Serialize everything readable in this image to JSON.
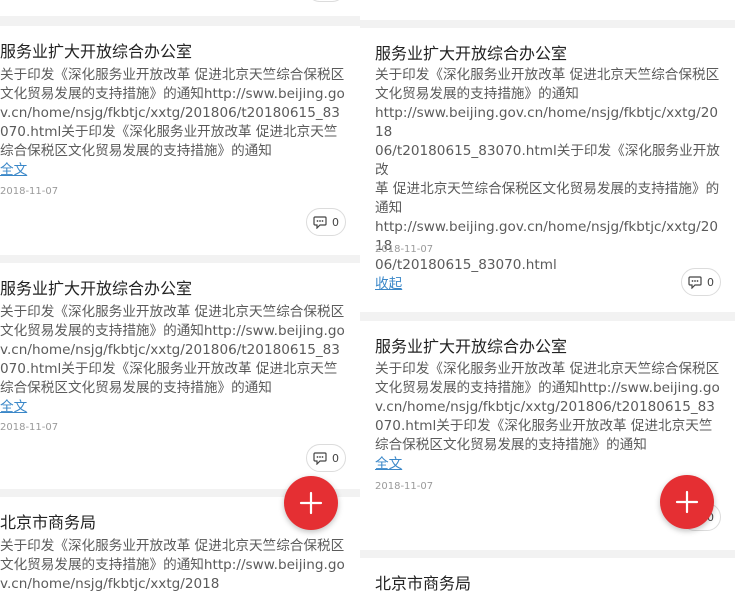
{
  "left_panel": {
    "cards": [
      {
        "title": "服务业扩大开放综合办公室",
        "body": "关于印发《深化服务业开放改革 促进北京天竺综合保税区文化贸易发展的支持措施》的通知http://sww.beijing.gov.cn/home/nsjg/fkbtjc/xxtg/201806/t20180615_83070.html关于印发《深化服务业开放改革 促进北京天竺综合保税区文化贸易发展的支持措施》的通知",
        "link": "全文",
        "date": "2018-11-07",
        "comments": "0"
      },
      {
        "title": "服务业扩大开放综合办公室",
        "body": "关于印发《深化服务业开放改革 促进北京天竺综合保税区文化贸易发展的支持措施》的通知http://sww.beijing.gov.cn/home/nsjg/fkbtjc/xxtg/201806/t20180615_83070.html关于印发《深化服务业开放改革 促进北京天竺综合保税区文化贸易发展的支持措施》的通知",
        "link": "全文",
        "date": "2018-11-07",
        "comments": "0"
      },
      {
        "title": "北京市商务局",
        "body": "关于印发《深化服务业开放改革 促进北京天竺综合保税区文化贸易发展的支持措施》的通知http://sww.beijing.gov.cn/home/nsjg/fkbtjc/xxtg/2018"
      }
    ]
  },
  "right_panel": {
    "cards": [
      {
        "title": "服务业扩大开放综合办公室",
        "body_lines": [
          "关于印发《深化服务业开放改革 促进北京天竺综合保税区",
          "文化贸易发展的支持措施》的通知",
          "http://sww.beijing.gov.cn/home/nsjg/fkbtjc/xxtg/2018",
          "06/t20180615_83070.html关于印发《深化服务业开放改",
          "革 促进北京天竺综合保税区文化贸易发展的支持措施》的",
          "通知",
          "http://sww.beijing.gov.cn/home/nsjg/fkbtjc/xxtg/2018",
          "06/t20180615_83070.html"
        ],
        "link": "收起",
        "date": "2018-11-07",
        "comments": "0"
      },
      {
        "title": "服务业扩大开放综合办公室",
        "body": "关于印发《深化服务业开放改革 促进北京天竺综合保税区文化贸易发展的支持措施》的通知http://sww.beijing.gov.cn/home/nsjg/fkbtjc/xxtg/201806/t20180615_83070.html关于印发《深化服务业开放改革 促进北京天竺综合保税区文化贸易发展的支持措施》的通知",
        "link": "全文",
        "date": "2018-11-07",
        "comments": "0"
      },
      {
        "title": "北京市商务局"
      }
    ]
  },
  "fab": {
    "icon": "plus-icon",
    "color": "#e52f33"
  },
  "colors": {
    "link": "#3a87c8",
    "divider": "#f2f2f2",
    "accent": "#e52f33"
  }
}
